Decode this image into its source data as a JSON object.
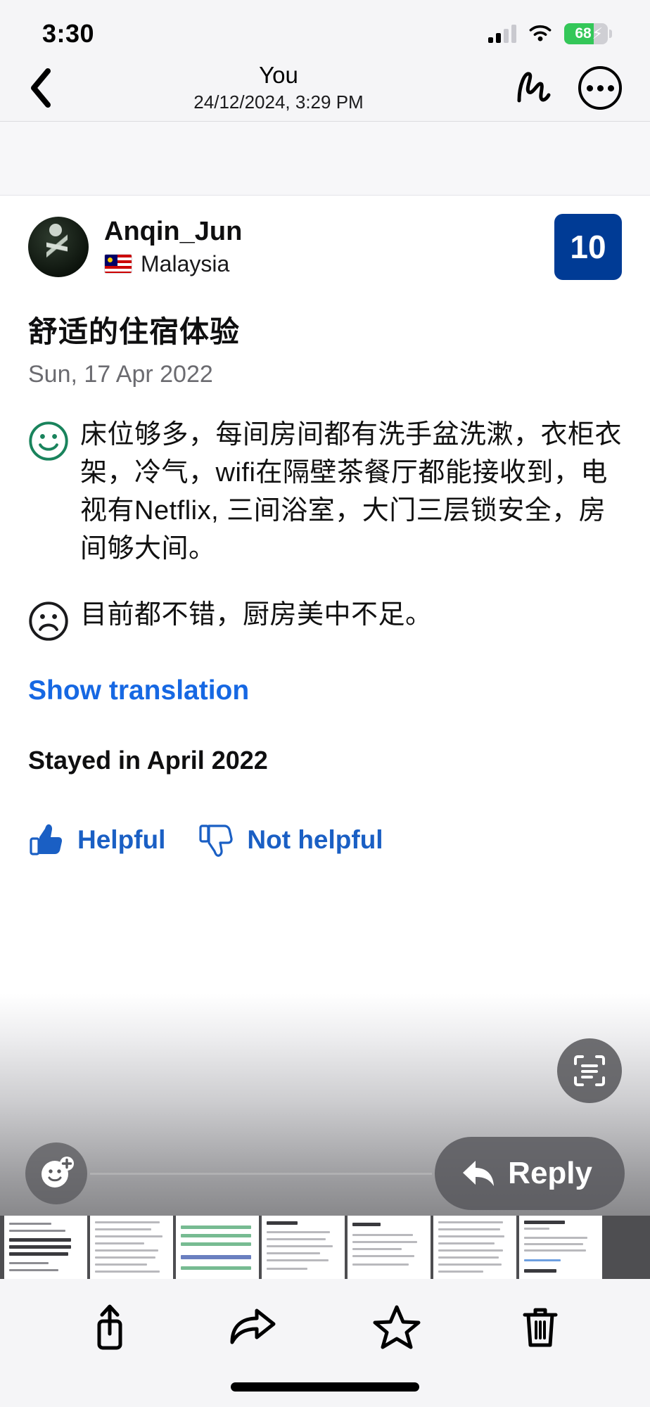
{
  "status_bar": {
    "time": "3:30",
    "battery_percent": "68",
    "battery_level": 68,
    "charging": true,
    "signal_icon": "cellular-signal-icon",
    "wifi_icon": "wifi-icon",
    "battery_icon": "battery-charging-icon"
  },
  "nav_bar": {
    "back_icon": "chevron-left-icon",
    "title": "You",
    "subtitle": "24/12/2024, 3:29 PM",
    "markup_icon": "markup-squiggle-icon",
    "more_icon": "more-ellipsis-icon"
  },
  "review": {
    "reviewer_name": "Anqin_Jun",
    "country": "Malaysia",
    "country_flag_icon": "flag-malaysia-icon",
    "avatar_icon": "avatar-image",
    "score": "10",
    "score_color": "#003b95",
    "title": "舒适的住宿体验",
    "date": "Sun, 17 Apr 2022",
    "positive_icon": "smiley-happy-icon",
    "positive_color": "#19835c",
    "positive_text": "床位够多，每间房间都有洗手盆洗漱，衣柜衣架，冷气，wifi在隔壁茶餐厅都能接收到，电视有Netflix, 三间浴室，大门三层锁安全，房间够大间。",
    "negative_icon": "smiley-sad-icon",
    "negative_color": "#1a1a1c",
    "negative_text": "目前都不错，厨房美中不足。",
    "translation_link": "Show translation",
    "translation_link_color": "#1668e3",
    "stayed_in": "Stayed in April 2022",
    "helpful_label": "Helpful",
    "helpful_icon": "thumbs-up-icon",
    "not_helpful_label": "Not helpful",
    "not_helpful_icon": "thumbs-down-icon",
    "vote_color": "#1a5fc4"
  },
  "overlay": {
    "live_text_icon": "live-text-scan-icon",
    "emoji_react_icon": "add-reaction-icon",
    "reply_label": "Reply",
    "reply_icon": "reply-arrow-icon"
  },
  "filmstrip": {
    "name": "screenshot-thumbnail-strip",
    "thumbnails": [
      {
        "id": "thumb-1",
        "style": "dark"
      },
      {
        "id": "thumb-2",
        "style": "plain"
      },
      {
        "id": "thumb-3",
        "style": "green"
      },
      {
        "id": "thumb-4",
        "style": "plain"
      },
      {
        "id": "thumb-5",
        "style": "plain"
      },
      {
        "id": "thumb-6",
        "style": "plain"
      },
      {
        "id": "thumb-7",
        "style": "blue"
      }
    ]
  },
  "toolbar": {
    "share_icon": "share-upload-icon",
    "forward_icon": "forward-arrow-icon",
    "favorite_icon": "star-outline-icon",
    "delete_icon": "trash-icon"
  }
}
